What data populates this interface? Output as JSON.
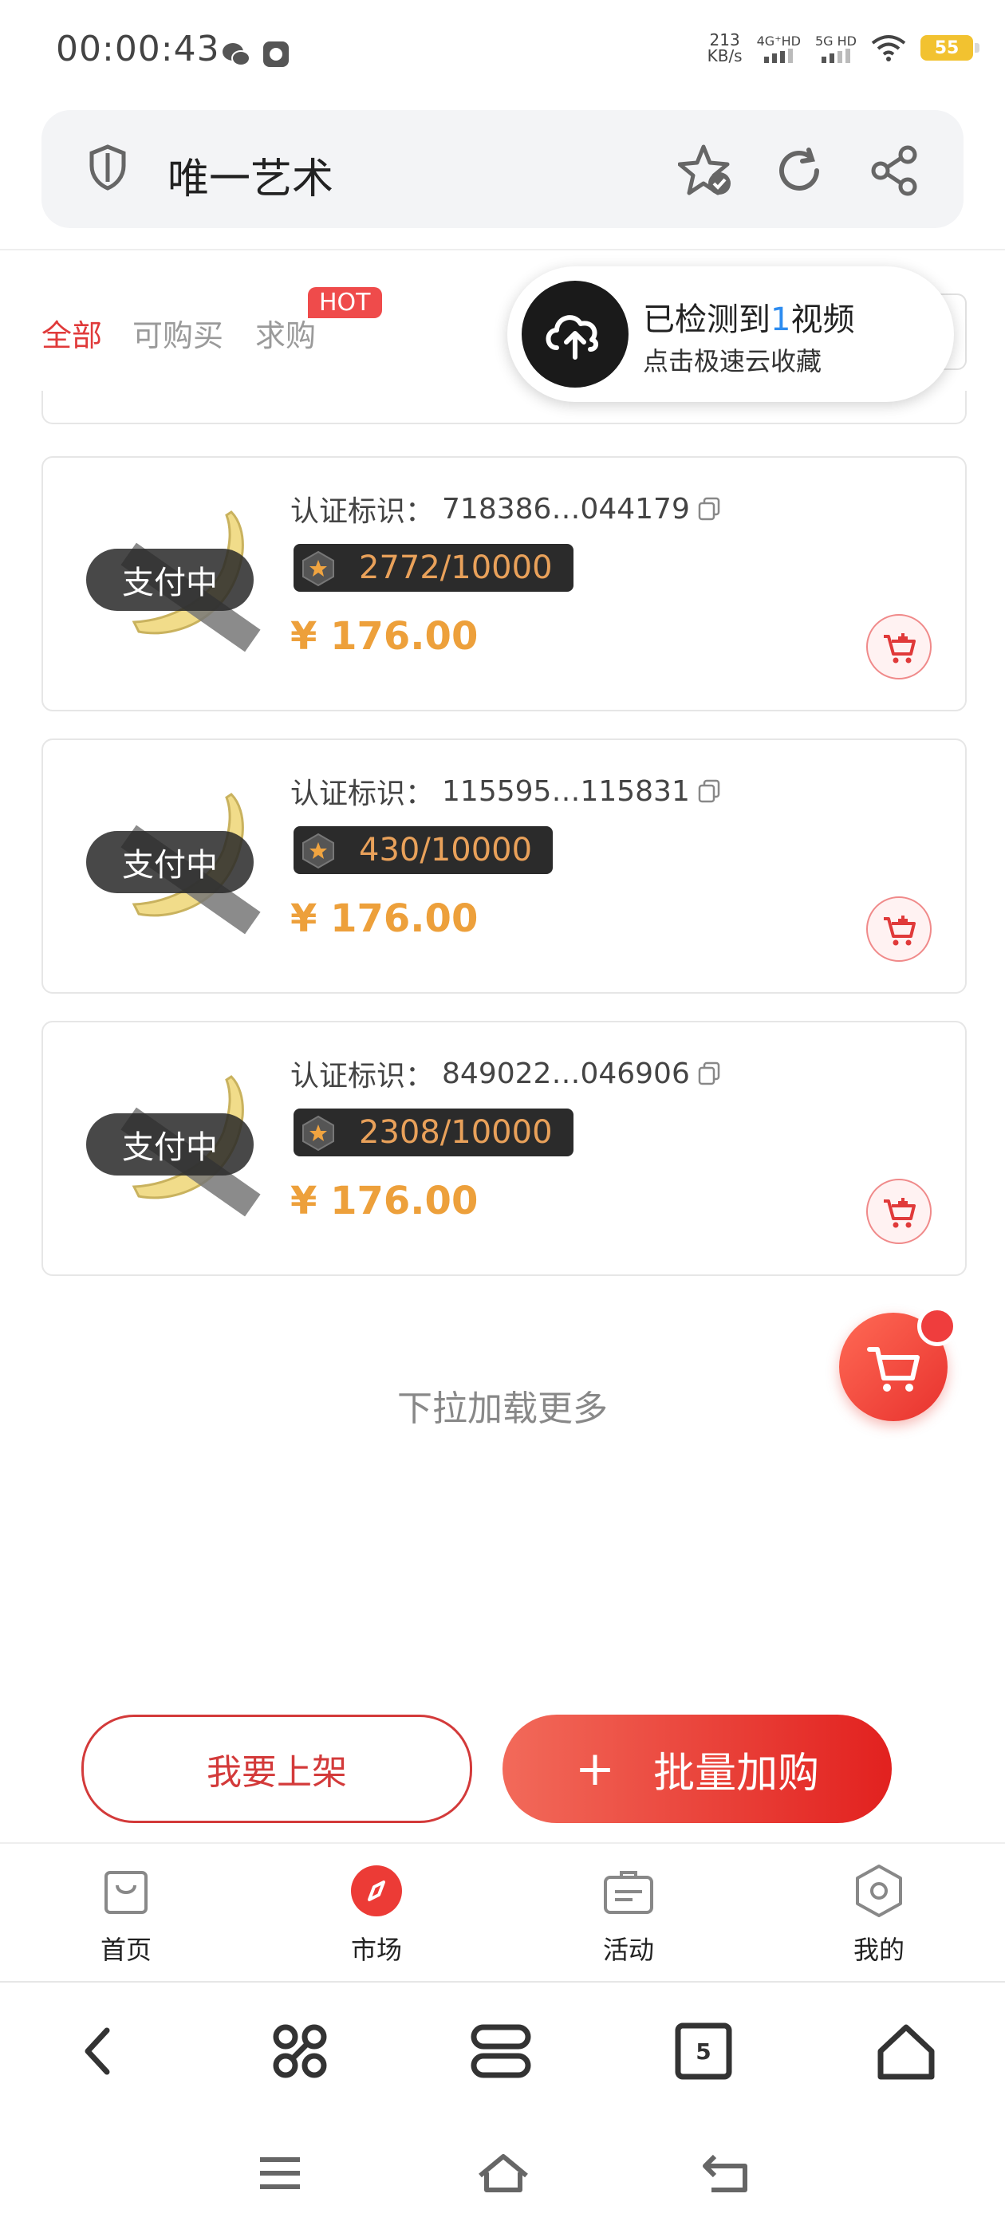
{
  "status_bar": {
    "time": "00:00:43",
    "net_speed_value": "213",
    "net_speed_unit": "KB/s",
    "sim1": "4G⁺HD",
    "sim2": "5G HD",
    "battery": "55"
  },
  "address_bar": {
    "title": "唯一艺术",
    "icons": [
      "shield-icon",
      "star-check-icon",
      "refresh-icon",
      "share-icon"
    ]
  },
  "filter_tabs": {
    "items": [
      {
        "label": "全部",
        "active": true
      },
      {
        "label": "可购买",
        "active": false
      },
      {
        "label": "求购",
        "active": false
      }
    ],
    "hot_badge": "HOT"
  },
  "toast": {
    "title_prefix": "已检测到",
    "title_num": "1",
    "title_suffix": "视频",
    "subtitle": "点击极速云收藏"
  },
  "cards": [
    {
      "status": "支付中",
      "cert_label": "认证标识：",
      "cert_id": "718386…044179",
      "serial": "2772/10000",
      "price": "¥ 176.00"
    },
    {
      "status": "支付中",
      "cert_label": "认证标识：",
      "cert_id": "115595…115831",
      "serial": "430/10000",
      "price": "¥ 176.00"
    },
    {
      "status": "支付中",
      "cert_label": "认证标识：",
      "cert_id": "849022…046906",
      "serial": "2308/10000",
      "price": "¥ 176.00"
    }
  ],
  "load_more": "下拉加载更多",
  "actions": {
    "list_label": "我要上架",
    "batch_label": "批量加购",
    "batch_plus": "+"
  },
  "bottom_nav": [
    {
      "label": "首页",
      "icon": "bag-icon",
      "active": false
    },
    {
      "label": "市场",
      "icon": "compass-icon",
      "active": true
    },
    {
      "label": "活动",
      "icon": "briefcase-icon",
      "active": false
    },
    {
      "label": "我的",
      "icon": "hexagon-icon",
      "active": false
    }
  ],
  "browser_toolbar": {
    "tab_count": "5",
    "icons": [
      "back-icon",
      "command-icon",
      "tabs-switch-icon",
      "tab-count-icon",
      "home-icon"
    ]
  },
  "system_nav": [
    "menu-icon",
    "home-icon",
    "back-icon"
  ],
  "colors": {
    "accent_red": "#e03a3a",
    "price_orange": "#eda03b",
    "serial_bg": "#2b2b2b"
  }
}
